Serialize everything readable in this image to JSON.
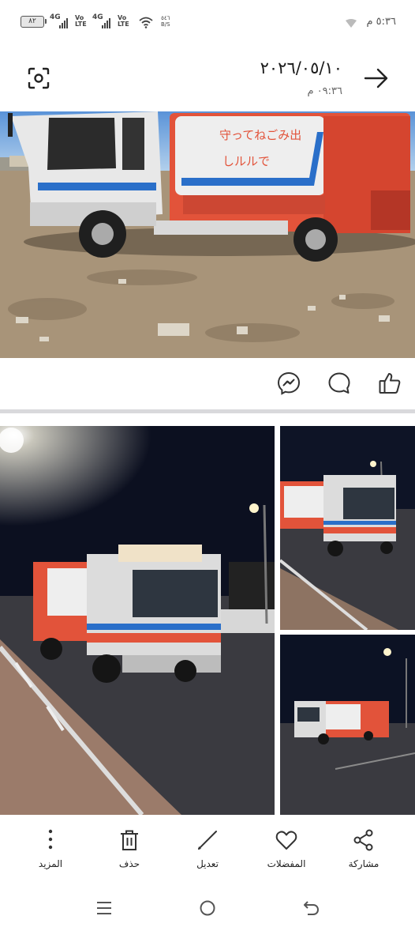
{
  "status_bar": {
    "battery": "٨٢",
    "network_1": "4G",
    "volte_1": "Vo\nLTE",
    "network_2": "4G",
    "volte_2": "Vo\nLTE",
    "speed_value": "٥٤٦",
    "speed_unit": "B/S",
    "time": "٥:٣٦ م"
  },
  "header": {
    "date": "٢٠٢٦/٠٥/١٠",
    "time": "٠٩:٣٦ م"
  },
  "photos": {
    "main_truck_text_top": "守ってねごみ出",
    "main_truck_text_bottom": "しルルで"
  },
  "toolbar": {
    "share": "مشاركة",
    "favorites": "المفضلات",
    "edit": "تعديل",
    "delete": "حذف",
    "more": "المزيد"
  },
  "colors": {
    "accent": "#2b2b2b",
    "truck_orange": "#e2533a",
    "truck_blue": "#2a6fc9",
    "night_sky": "#0c1020",
    "road": "#3a3a40",
    "dirt": "#a89479"
  }
}
